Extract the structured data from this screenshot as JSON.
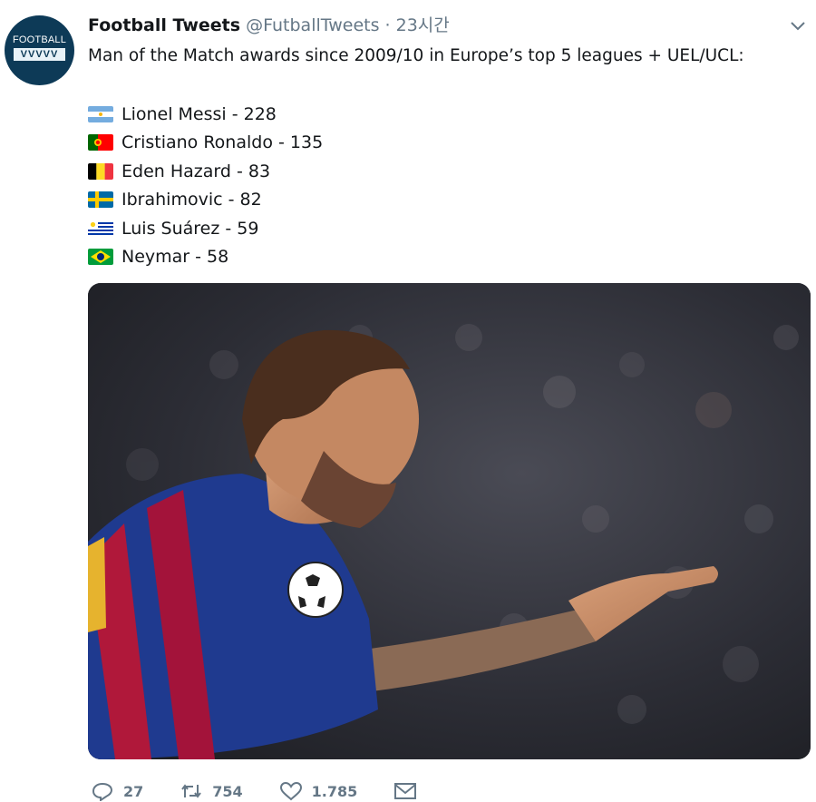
{
  "tweet": {
    "author_name": "Football Tweets",
    "handle": "@FutballTweets",
    "separator": "·",
    "time": "23시간",
    "avatar_text": "FOOTBALL",
    "avatar_mark": "VVVVV",
    "text": "Man of the Match awards since 2009/10 in Europe’s top 5 leagues + UEL/UCL:",
    "rankings": [
      {
        "flag": "argentina-flag",
        "label": "Lionel Messi - 228"
      },
      {
        "flag": "portugal-flag",
        "label": "Cristiano Ronaldo - 135"
      },
      {
        "flag": "belgium-flag",
        "label": "Eden Hazard - 83"
      },
      {
        "flag": "sweden-flag",
        "label": "Ibrahimovic - 82"
      },
      {
        "flag": "uruguay-flag",
        "label": "Luis Suárez - 59"
      },
      {
        "flag": "brazil-flag",
        "label": "Neymar - 58"
      }
    ],
    "actions": {
      "replies": "27",
      "retweets": "754",
      "likes": "1.785"
    }
  },
  "colors": {
    "muted": "#657786",
    "text": "#14171a",
    "avatar_bg": "#0d3a57"
  }
}
